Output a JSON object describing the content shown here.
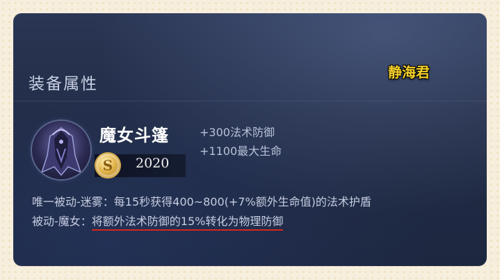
{
  "watermark": "静海君",
  "header": {
    "title": "装备属性"
  },
  "item": {
    "name": "魔女斗篷",
    "icon": "witch-cloak-icon",
    "currency_icon": "gold-coin-icon",
    "currency_symbol": "S",
    "price": "2020",
    "stats": [
      "+300法术防御",
      "+1100最大生命"
    ]
  },
  "passives": [
    {
      "label": "唯一被动-迷雾：",
      "text": "每15秒获得400~800(+7%额外生命值)的法术护盾"
    },
    {
      "label": "被动-魔女：",
      "text": "将额外法术防御的15%转化为物理防御"
    }
  ],
  "colors": {
    "highlight_underline": "#d8261f",
    "watermark": "#f4d02a"
  }
}
